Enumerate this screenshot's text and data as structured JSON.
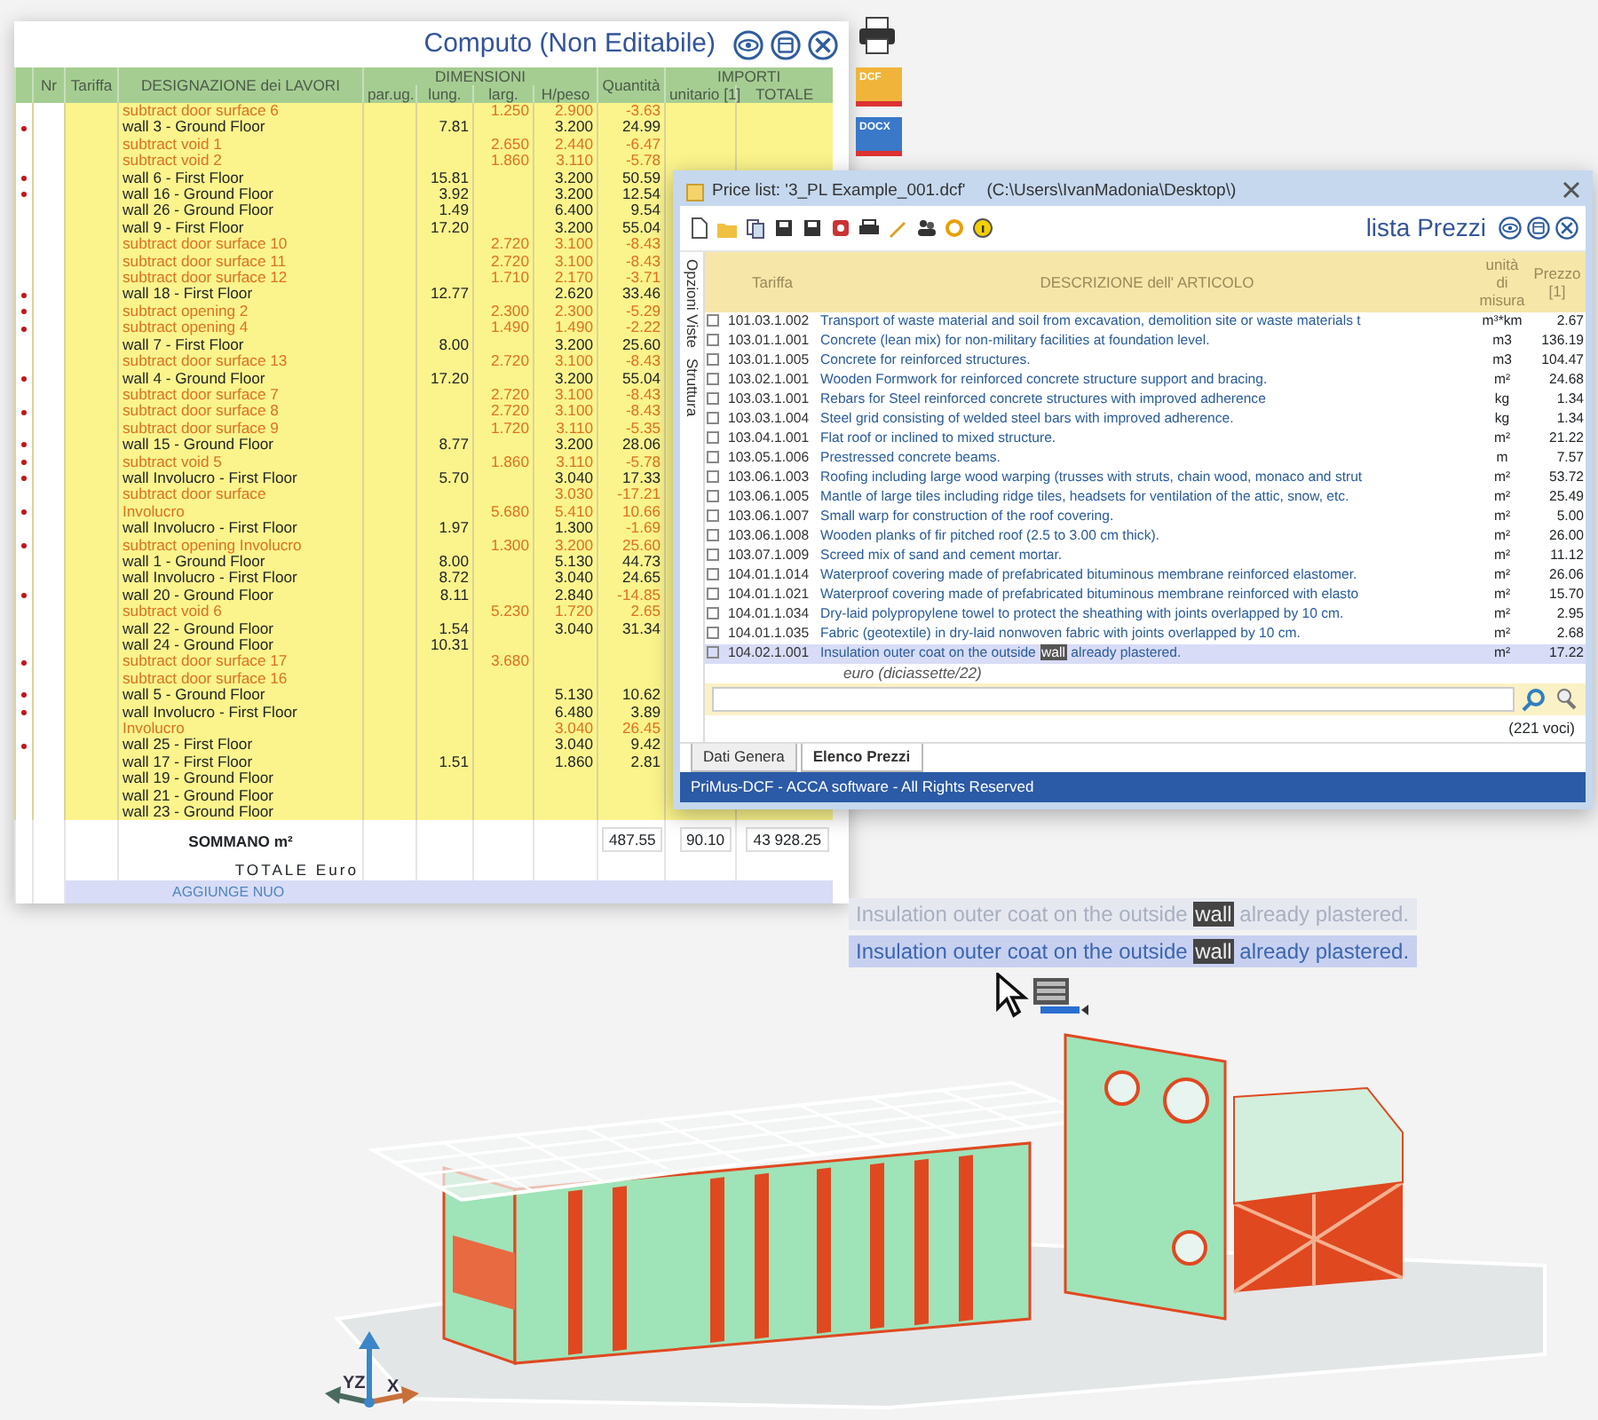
{
  "computo": {
    "title": "Computo (Non Editabile)",
    "group_dimensioni": "DIMENSIONI",
    "group_importi": "IMPORTI",
    "columns": [
      "Nr",
      "Tariffa",
      "DESIGNAZIONE dei LAVORI",
      "par.ug.",
      "lung.",
      "larg.",
      "H/peso",
      "Quantità",
      "unitario [1]",
      "TOTALE"
    ],
    "rows": [
      {
        "kind": "subtract",
        "marked": false,
        "designation": "subtract door surface 6",
        "lung": "",
        "larg": "1.250",
        "hpeso": "2.900",
        "quantita": "-3.63"
      },
      {
        "kind": "wall",
        "marked": true,
        "designation": "wall 3 - Ground Floor",
        "lung": "7.81",
        "larg": "",
        "hpeso": "3.200",
        "quantita": "24.99"
      },
      {
        "kind": "subtract",
        "marked": false,
        "designation": "subtract void 1",
        "lung": "",
        "larg": "2.650",
        "hpeso": "2.440",
        "quantita": "-6.47"
      },
      {
        "kind": "subtract",
        "marked": false,
        "designation": "subtract void 2",
        "lung": "",
        "larg": "1.860",
        "hpeso": "3.110",
        "quantita": "-5.78"
      },
      {
        "kind": "wall",
        "marked": true,
        "designation": "wall 6 - First Floor",
        "lung": "15.81",
        "larg": "",
        "hpeso": "3.200",
        "quantita": "50.59"
      },
      {
        "kind": "wall",
        "marked": true,
        "designation": "wall 16 - Ground Floor",
        "lung": "3.92",
        "larg": "",
        "hpeso": "3.200",
        "quantita": "12.54"
      },
      {
        "kind": "wall",
        "marked": false,
        "designation": "wall 26 - Ground Floor",
        "lung": "1.49",
        "larg": "",
        "hpeso": "6.400",
        "quantita": "9.54"
      },
      {
        "kind": "wall",
        "marked": false,
        "designation": "wall 9 - First Floor",
        "lung": "17.20",
        "larg": "",
        "hpeso": "3.200",
        "quantita": "55.04"
      },
      {
        "kind": "subtract",
        "marked": false,
        "designation": "subtract door surface 10",
        "lung": "",
        "larg": "2.720",
        "hpeso": "3.100",
        "quantita": "-8.43"
      },
      {
        "kind": "subtract",
        "marked": false,
        "designation": "subtract door surface 11",
        "lung": "",
        "larg": "2.720",
        "hpeso": "3.100",
        "quantita": "-8.43"
      },
      {
        "kind": "subtract",
        "marked": false,
        "designation": "subtract door surface 12",
        "lung": "",
        "larg": "1.710",
        "hpeso": "2.170",
        "quantita": "-3.71"
      },
      {
        "kind": "wall",
        "marked": true,
        "designation": "wall 18 - First Floor",
        "lung": "12.77",
        "larg": "",
        "hpeso": "2.620",
        "quantita": "33.46"
      },
      {
        "kind": "subtract",
        "marked": true,
        "designation": "subtract opening 2",
        "lung": "",
        "larg": "2.300",
        "hpeso": "2.300",
        "quantita": "-5.29"
      },
      {
        "kind": "subtract",
        "marked": true,
        "designation": "subtract opening 4",
        "lung": "",
        "larg": "1.490",
        "hpeso": "1.490",
        "quantita": "-2.22"
      },
      {
        "kind": "wall",
        "marked": false,
        "designation": "wall 7 - First Floor",
        "lung": "8.00",
        "larg": "",
        "hpeso": "3.200",
        "quantita": "25.60"
      },
      {
        "kind": "subtract",
        "marked": false,
        "designation": "subtract door surface 13",
        "lung": "",
        "larg": "2.720",
        "hpeso": "3.100",
        "quantita": "-8.43"
      },
      {
        "kind": "wall",
        "marked": true,
        "designation": "wall 4 - Ground Floor",
        "lung": "17.20",
        "larg": "",
        "hpeso": "3.200",
        "quantita": "55.04"
      },
      {
        "kind": "subtract",
        "marked": false,
        "designation": "subtract door surface 7",
        "lung": "",
        "larg": "2.720",
        "hpeso": "3.100",
        "quantita": "-8.43"
      },
      {
        "kind": "subtract",
        "marked": true,
        "designation": "subtract door surface 8",
        "lung": "",
        "larg": "2.720",
        "hpeso": "3.100",
        "quantita": "-8.43"
      },
      {
        "kind": "subtract",
        "marked": false,
        "designation": "subtract door surface 9",
        "lung": "",
        "larg": "1.720",
        "hpeso": "3.110",
        "quantita": "-5.35"
      },
      {
        "kind": "wall",
        "marked": true,
        "designation": "wall 15 - Ground Floor",
        "lung": "8.77",
        "larg": "",
        "hpeso": "3.200",
        "quantita": "28.06"
      },
      {
        "kind": "subtract",
        "marked": true,
        "designation": "subtract void 5",
        "lung": "",
        "larg": "1.860",
        "hpeso": "3.110",
        "quantita": "-5.78"
      },
      {
        "kind": "wall",
        "marked": true,
        "designation": "wall Involucro - First Floor",
        "lung": "5.70",
        "larg": "",
        "hpeso": "3.040",
        "quantita": "17.33"
      },
      {
        "kind": "subtract",
        "marked": false,
        "designation": "subtract door surface",
        "lung": "",
        "larg": "",
        "hpeso": "3.030",
        "quantita": "-17.21"
      },
      {
        "kind": "subtract",
        "marked": true,
        "designation": "Involucro",
        "lung": "",
        "larg": "5.680",
        "hpeso": "5.410",
        "quantita": "10.66"
      },
      {
        "kind": "wall",
        "marked": false,
        "designation": "wall Involucro - First Floor",
        "lung": "1.97",
        "larg": "",
        "hpeso": "1.300",
        "quantita": "-1.69"
      },
      {
        "kind": "subtract",
        "marked": true,
        "designation": "subtract opening Involucro",
        "lung": "",
        "larg": "1.300",
        "hpeso": "3.200",
        "quantita": "25.60"
      },
      {
        "kind": "wall",
        "marked": false,
        "designation": "wall 1 - Ground Floor",
        "lung": "8.00",
        "larg": "",
        "hpeso": "5.130",
        "quantita": "44.73"
      },
      {
        "kind": "wall",
        "marked": false,
        "designation": "wall Involucro - First Floor",
        "lung": "8.72",
        "larg": "",
        "hpeso": "3.040",
        "quantita": "24.65"
      },
      {
        "kind": "wall",
        "marked": true,
        "designation": "wall 20 - Ground Floor",
        "lung": "8.11",
        "larg": "",
        "hpeso": "2.840",
        "quantita": "-14.85"
      },
      {
        "kind": "subtract",
        "marked": false,
        "designation": "subtract void 6",
        "lung": "",
        "larg": "5.230",
        "hpeso": "1.720",
        "quantita": "2.65"
      },
      {
        "kind": "wall",
        "marked": false,
        "designation": "wall 22 - Ground Floor",
        "lung": "1.54",
        "larg": "",
        "hpeso": "3.040",
        "quantita": "31.34"
      },
      {
        "kind": "wall",
        "marked": false,
        "designation": "wall 24 - Ground Floor",
        "lung": "10.31",
        "larg": "",
        "hpeso": "",
        "quantita": ""
      },
      {
        "kind": "subtract",
        "marked": true,
        "designation": "subtract door surface 17",
        "lung": "",
        "larg": "3.680",
        "hpeso": "",
        "quantita": ""
      },
      {
        "kind": "subtract",
        "marked": false,
        "designation": "subtract door surface 16",
        "lung": "",
        "larg": "",
        "hpeso": "",
        "quantita": ""
      },
      {
        "kind": "wall",
        "marked": true,
        "designation": "wall 5 - Ground Floor",
        "lung": "",
        "larg": "",
        "hpeso": "5.130",
        "quantita": "10.62"
      },
      {
        "kind": "wall",
        "marked": true,
        "designation": "wall Involucro - First Floor",
        "lung": "",
        "larg": "",
        "hpeso": "6.480",
        "quantita": "3.89"
      },
      {
        "kind": "subtract",
        "marked": false,
        "designation": "Involucro",
        "lung": "",
        "larg": "",
        "hpeso": "3.040",
        "quantita": "26.45"
      },
      {
        "kind": "wall",
        "marked": true,
        "designation": "wall 25 - First Floor",
        "lung": "",
        "larg": "",
        "hpeso": "3.040",
        "quantita": "9.42"
      },
      {
        "kind": "wall",
        "marked": false,
        "designation": "wall 17 - First Floor",
        "lung": "1.51",
        "larg": "",
        "hpeso": "1.860",
        "quantita": "2.81"
      },
      {
        "kind": "wall",
        "marked": false,
        "designation": "wall 19 - Ground Floor",
        "lung": "",
        "larg": "",
        "hpeso": "",
        "quantita": ""
      },
      {
        "kind": "wall",
        "marked": false,
        "designation": "wall 21 - Ground Floor",
        "lung": "",
        "larg": "",
        "hpeso": "",
        "quantita": ""
      },
      {
        "kind": "wall",
        "marked": false,
        "designation": "wall 23 - Ground Floor",
        "lung": "",
        "larg": "",
        "hpeso": "",
        "quantita": ""
      }
    ],
    "sum_row": {
      "label": "SOMMANO m²",
      "quantita": "487.55",
      "unitario": "90.10",
      "totale": "43 928.25"
    },
    "total_label": "TOTALE Euro",
    "add_link": "AGGIUNGE NUO"
  },
  "export_buttons": [
    {
      "kind": "print"
    },
    {
      "kind": "dcf",
      "label": "DCF"
    },
    {
      "kind": "docx",
      "label": "DOCX"
    }
  ],
  "price_list": {
    "title": "Price list: '3_PL Example_001.dcf'",
    "path": "(C:\\Users\\IvanMadonia\\Desktop\\)",
    "heading": "lista Prezzi",
    "side_tabs": [
      "Opzioni Viste",
      "Struttura"
    ],
    "columns": [
      "Tariffa",
      "DESCRIZIONE dell' ARTICOLO",
      "unità di misura",
      "Prezzo [1]"
    ],
    "rows": [
      {
        "code": "101.03.1.002",
        "description": "Transport of waste material and soil from excavation, demolition site or waste materials t",
        "unit": "m³*km",
        "price": "2.67",
        "selected": false
      },
      {
        "code": "103.01.1.001",
        "description": "Concrete (lean mix) for non-military facilities at foundation level.",
        "unit": "m3",
        "price": "136.19",
        "selected": false
      },
      {
        "code": "103.01.1.005",
        "description": "Concrete for reinforced structures.",
        "unit": "m3",
        "price": "104.47",
        "selected": false
      },
      {
        "code": "103.02.1.001",
        "description": "Wooden Formwork for reinforced concrete structure support and bracing.",
        "unit": "m²",
        "price": "24.68",
        "selected": false
      },
      {
        "code": "103.03.1.001",
        "description": "Rebars for Steel reinforced concrete structures with improved adherence",
        "unit": "kg",
        "price": "1.34",
        "selected": false
      },
      {
        "code": "103.03.1.004",
        "description": "Steel grid consisting of welded steel bars with improved adherence.",
        "unit": "kg",
        "price": "1.34",
        "selected": false
      },
      {
        "code": "103.04.1.001",
        "description": "Flat roof or inclined to mixed structure.",
        "unit": "m²",
        "price": "21.22",
        "selected": false
      },
      {
        "code": "103.05.1.006",
        "description": "Prestressed concrete beams.",
        "unit": "m",
        "price": "7.57",
        "selected": false
      },
      {
        "code": "103.06.1.003",
        "description": "Roofing including large wood warping (trusses with struts, chain wood, monaco and strut",
        "unit": "m²",
        "price": "53.72",
        "selected": false
      },
      {
        "code": "103.06.1.005",
        "description": "Mantle of large tiles including ridge tiles, headsets for ventilation of the attic, snow, etc.",
        "unit": "m²",
        "price": "25.49",
        "selected": false
      },
      {
        "code": "103.06.1.007",
        "description": "Small warp for construction of the roof covering.",
        "unit": "m²",
        "price": "5.00",
        "selected": false
      },
      {
        "code": "103.06.1.008",
        "description": "Wooden planks of fir pitched roof (2.5 to 3.00 cm thick).",
        "unit": "m²",
        "price": "26.00",
        "selected": false
      },
      {
        "code": "103.07.1.009",
        "description": "Screed mix of sand and cement mortar.",
        "unit": "m²",
        "price": "11.12",
        "selected": false
      },
      {
        "code": "104.01.1.014",
        "description": "Waterproof covering made of prefabricated bituminous membrane reinforced elastomer.",
        "unit": "m²",
        "price": "26.06",
        "selected": false
      },
      {
        "code": "104.01.1.021",
        "description": "Waterproof covering made of prefabricated bituminous membrane reinforced with elasto",
        "unit": "m²",
        "price": "15.70",
        "selected": false
      },
      {
        "code": "104.01.1.034",
        "description": "Dry-laid polypropylene towel to protect the sheathing with joints overlapped by 10 cm.",
        "unit": "m²",
        "price": "2.95",
        "selected": false
      },
      {
        "code": "104.01.1.035",
        "description": "Fabric (geotextile) in dry-laid nonwoven fabric with joints overlapped by 10 cm.",
        "unit": "m²",
        "price": "2.68",
        "selected": false
      },
      {
        "code": "104.02.1.001",
        "description": "Insulation outer coat on the outside",
        "highlight": "wall",
        "description_end": "already plastered.",
        "unit": "m²",
        "price": "17.22",
        "selected": true
      }
    ],
    "price_words": "euro (diciassette/22)",
    "count": "(221 voci)",
    "tabs": [
      {
        "label": "Dati Genera",
        "selected": false
      },
      {
        "label": "Elenco Prezzi",
        "selected": true
      }
    ],
    "status_bar": "PriMus-DCF - ACCA software - All Rights Reserved"
  },
  "drag_ghosts": [
    {
      "text": "Insulation outer coat on the outside",
      "highlight": "wall",
      "text_end": "already plastered.",
      "faded": true
    },
    {
      "text": "Insulation outer coat on the outside",
      "highlight": "wall",
      "text_end": "already plastered.",
      "faded": false
    }
  ],
  "model": {
    "axis_labels": [
      "YZ",
      "X"
    ]
  }
}
